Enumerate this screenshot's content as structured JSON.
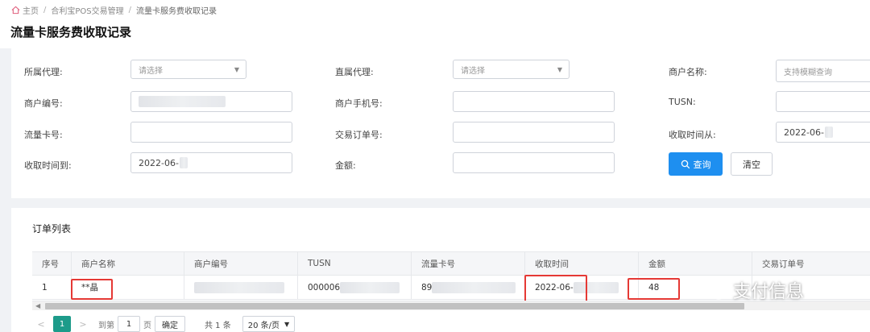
{
  "breadcrumb": {
    "home": "主页",
    "sep": "/",
    "level1": "合利宝POS交易管理",
    "current": "流量卡服务费收取记录"
  },
  "page_title": "流量卡服务费收取记录",
  "filters": {
    "agent_label": "所属代理:",
    "agent_placeholder": "请选择",
    "direct_agent_label": "直属代理:",
    "direct_agent_placeholder": "请选择",
    "merchant_name_label": "商户名称:",
    "merchant_name_placeholder": "支持模糊查询",
    "merchant_no_label": "商户编号:",
    "merchant_phone_label": "商户手机号:",
    "tusn_label": "TUSN:",
    "sim_card_label": "流量卡号:",
    "order_no_label": "交易订单号:",
    "time_from_label": "收取时间从:",
    "time_from_value": "2022-06-",
    "time_to_label": "收取时间到:",
    "time_to_value": "2022-06-",
    "amount_label": "金额:"
  },
  "buttons": {
    "search": "查询",
    "clear": "清空"
  },
  "list": {
    "title": "订单列表",
    "columns": [
      "序号",
      "商户名称",
      "商户编号",
      "TUSN",
      "流量卡号",
      "收取时间",
      "金额",
      "交易订单号"
    ],
    "rows": [
      {
        "index": "1",
        "merchant_name": "**晶",
        "merchant_no": "",
        "tusn": "000006",
        "sim_card": "89",
        "time": "2022-06-",
        "amount": "48",
        "order_no": ""
      }
    ]
  },
  "pagination": {
    "prev": "<",
    "current_page": "1",
    "next": ">",
    "goto_label": "到第",
    "goto_value": "1",
    "page_unit": "页",
    "confirm": "确定",
    "total": "共 1 条",
    "page_size": "20 条/页"
  },
  "watermark": "支付信息",
  "colors": {
    "primary_button": "#1e8ff0",
    "active_page": "#1d9b8a",
    "highlight_box": "#e53935"
  }
}
